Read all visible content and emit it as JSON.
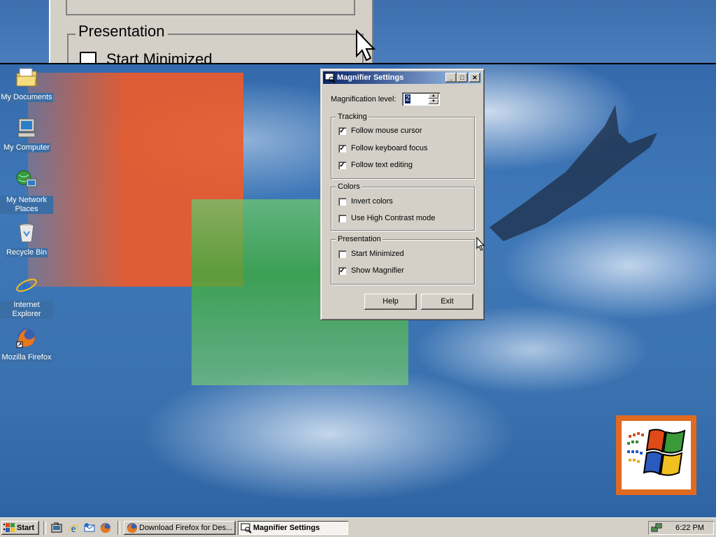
{
  "desktop": {
    "icons": [
      {
        "label": "My Documents",
        "icon": "my-documents-icon"
      },
      {
        "label": "My Computer",
        "icon": "my-computer-icon"
      },
      {
        "label": "My Network Places",
        "icon": "network-places-icon"
      },
      {
        "label": "Recycle Bin",
        "icon": "recycle-bin-icon"
      },
      {
        "label": "Internet Explorer",
        "icon": "internet-explorer-icon"
      },
      {
        "label": "Mozilla Firefox",
        "icon": "firefox-icon"
      }
    ]
  },
  "magnified_view": {
    "legend": "Presentation",
    "checkbox_text": "Start Minimized"
  },
  "dialog": {
    "title": "Magnifier Settings",
    "magnification_label": "Magnification level:",
    "magnification_value": "2",
    "tracking": {
      "legend": "Tracking",
      "options": [
        {
          "label": "Follow mouse cursor",
          "checked": true
        },
        {
          "label": "Follow keyboard focus",
          "checked": true
        },
        {
          "label": "Follow text editing",
          "checked": true
        }
      ]
    },
    "colors": {
      "legend": "Colors",
      "options": [
        {
          "label": "Invert colors",
          "checked": false
        },
        {
          "label": "Use High Contrast mode",
          "checked": false
        }
      ]
    },
    "presentation": {
      "legend": "Presentation",
      "options": [
        {
          "label": "Start Minimized",
          "checked": false
        },
        {
          "label": "Show Magnifier",
          "checked": true
        }
      ]
    },
    "help_label": "Help",
    "exit_label": "Exit"
  },
  "taskbar": {
    "start_label": "Start",
    "tasks": [
      {
        "label": "Download Firefox for Des...",
        "active": false,
        "icon": "firefox-icon"
      },
      {
        "label": "Magnifier Settings",
        "active": true,
        "icon": "magnifier-icon"
      }
    ],
    "clock": "6:22 PM"
  },
  "colors": {
    "title_bar_start": "#0a246a",
    "title_bar_end": "#a6caf0",
    "button_face": "#d4d0c8",
    "desktop": "#3a6ea5"
  }
}
